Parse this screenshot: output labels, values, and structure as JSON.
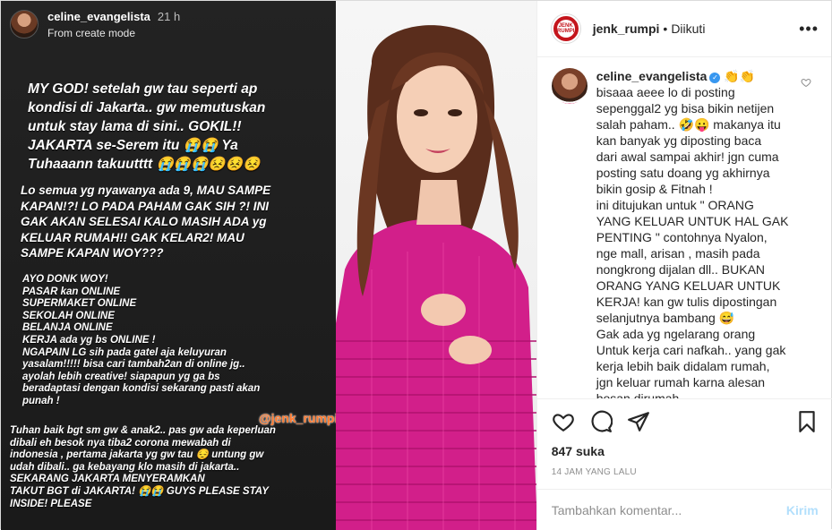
{
  "story": {
    "username": "celine_evangelista",
    "time": "21 h",
    "subtitle": "From create mode",
    "block1": "MY GOD! setelah gw tau seperti ap\nkondisi di Jakarta.. gw memutuskan\nuntuk stay lama di sini.. GOKIL!!\nJAKARTA se-Serem itu 😭😭 Ya\nTuhaaann takuutttt 😭😭😭😣😣😣",
    "block2": "Lo semua yg nyawanya ada 9, MAU SAMPE\nKAPAN!?! LO PADA PAHAM GAK SIH ?! INI\nGAK AKAN SELESAI KALO MASIH ADA yg\nKELUAR RUMAH!! GAK KELAR2! MAU\nSAMPE KAPAN WOY???",
    "block3": "AYO DONK WOY!\nPASAR kan ONLINE\nSUPERMAKET ONLINE\nSEKOLAH ONLINE\nBELANJA ONLINE\nKERJA ada yg bs ONLINE !\nNGAPAIN LG sih pada gatel aja keluyuran\nyasalam!!!!! bisa cari tambah2an di online jg..\nayolah lebih creative! siapapun yg ga bs\nberadaptasi dengan kondisi sekarang pasti akan\npunah !",
    "block4": "Tuhan baik bgt sm gw & anak2.. pas gw ada keperluan\ndibali eh besok nya tiba2 corona mewabah di\nindonesia , pertama jakarta yg gw tau 😔 untung gw\nudah dibali.. ga kebayang klo masih di jakarta..\nSEKARANG JAKARTA MENYERAMKAN\nTAKUT BGT di JAKARTA! 😭😭 GUYS PLEASE STAY\nINSIDE! PLEASE",
    "watermark": "@jenk_rumpi"
  },
  "header": {
    "logo_text": "JENK RUMPI",
    "username": "jenk_rumpi",
    "dot": "•",
    "follow_status": "Diikuti",
    "more": "•••"
  },
  "caption": {
    "username": "celine_evangelista",
    "verified_mark": "✓",
    "emojis": "👏👏",
    "text": "bisaaa aeee lo di posting\nsepenggal2 yg bisa bikin netijen\nsalah paham.. 🤣😛 makanya itu\nkan banyak yg diposting baca\ndari awal sampai akhir! jgn cuma\nposting satu doang yg akhirnya\nbikin gosip & Fitnah !\nini ditujukan untuk \" ORANG\nYANG KELUAR UNTUK HAL GAK\nPENTING \" contohnya Nyalon,\nnge mall, arisan , masih pada\nnongkrong dijalan dll.. BUKAN\nORANG YANG KELUAR UNTUK\nKERJA! kan gw tulis dipostingan\nselanjutnya bambang 😅\nGak ada yg ngelarang orang\nUntuk kerja cari nafkah.. yang gak\nkerja lebih baik didalam rumah,\njgn keluar rumah karna alesan\nbosan dirumah.."
  },
  "stats": {
    "likes": "847 suka",
    "time_ago": "14 JAM YANG LALU"
  },
  "comment_box": {
    "placeholder": "Tambahkan komentar...",
    "post_label": "Kirim"
  },
  "colors": {
    "brand_red": "#c4151c",
    "verified_blue": "#3897f0",
    "post_button": "#b2dffc",
    "watermark": "#ff7a2f",
    "dress_pink": "#d21f8a"
  },
  "icons": [
    "heart-icon",
    "comment-icon",
    "share-icon",
    "bookmark-icon",
    "more-options-icon",
    "small-heart-icon",
    "verified-badge-icon"
  ]
}
